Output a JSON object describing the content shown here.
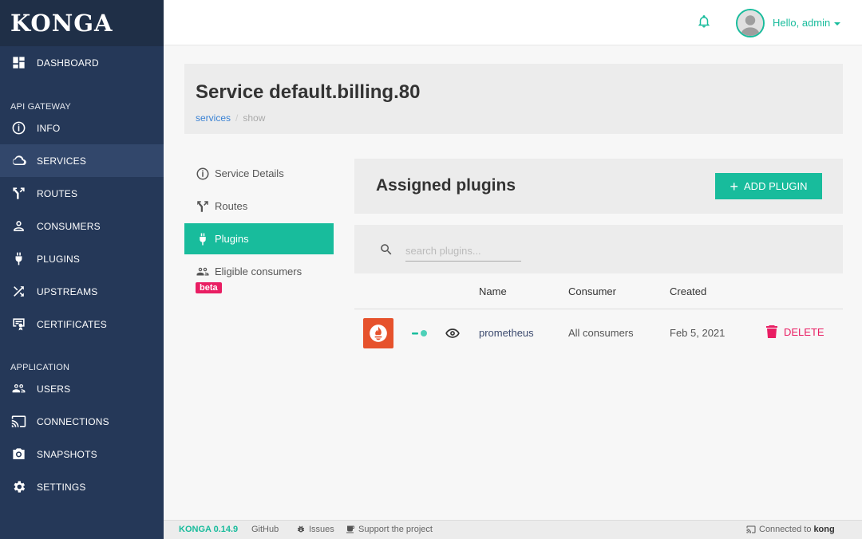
{
  "app": {
    "logo": "KONGA"
  },
  "sidebar": {
    "dashboard": "DASHBOARD",
    "section_api": "API GATEWAY",
    "info": "INFO",
    "services": "SERVICES",
    "routes": "ROUTES",
    "consumers": "CONSUMERS",
    "plugins": "PLUGINS",
    "upstreams": "UPSTREAMS",
    "certificates": "CERTIFICATES",
    "section_app": "APPLICATION",
    "users": "USERS",
    "connections": "CONNECTIONS",
    "snapshots": "SNAPSHOTS",
    "settings": "SETTINGS",
    "active_item": "SERVICES"
  },
  "header": {
    "greeting": "Hello, admin"
  },
  "page": {
    "title": "Service default.billing.80",
    "breadcrumb": {
      "link": "services",
      "separator": "/",
      "current": "show"
    }
  },
  "submenu": {
    "service_details": "Service Details",
    "routes": "Routes",
    "plugins": "Plugins",
    "eligible_consumers": "Eligible consumers",
    "beta_badge": "beta",
    "active_item": "Plugins"
  },
  "plugins_panel": {
    "title": "Assigned plugins",
    "add_button": "ADD PLUGIN",
    "search_placeholder": "search plugins...",
    "columns": {
      "name": "Name",
      "consumer": "Consumer",
      "created": "Created"
    },
    "rows": [
      {
        "name": "prometheus",
        "consumer": "All consumers",
        "created": "Feb 5, 2021",
        "delete_label": "DELETE",
        "enabled": true
      }
    ]
  },
  "footer": {
    "version": "KONGA 0.14.9",
    "github": "GitHub",
    "issues": "Issues",
    "support": "Support the project",
    "connected_prefix": "Connected to",
    "connected_target": "kong"
  },
  "colors": {
    "accent": "#18bc9c",
    "sidebar": "#253858",
    "danger": "#e91e63",
    "prometheus": "#e6522c"
  }
}
